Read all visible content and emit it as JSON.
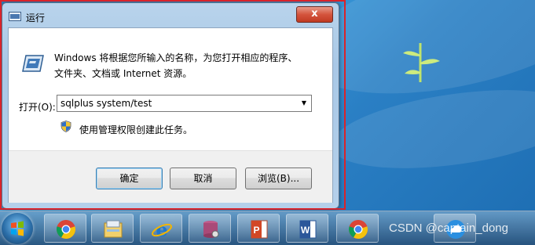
{
  "window": {
    "title": "运行",
    "close_label": "x"
  },
  "dialog": {
    "description_line1": "Windows 将根据您所输入的名称，为您打开相应的程序、",
    "description_line2": "文件夹、文档或 Internet 资源。",
    "open_label": "打开(O):",
    "open_value": "sqlplus system/test",
    "admin_note": "使用管理权限创建此任务。",
    "buttons": {
      "ok": "确定",
      "cancel": "取消",
      "browse": "浏览(B)..."
    }
  },
  "taskbar": {
    "items": [
      "chrome-icon",
      "file-explorer-icon",
      "internet-explorer-icon",
      "database-tool-icon",
      "powerpoint-icon",
      "word-icon",
      "chrome-icon",
      "cloud-app-icon"
    ]
  },
  "watermark": "CSDN @captain_dong",
  "colors": {
    "annotation_red": "#d9232a",
    "close_button": "#c8432b",
    "desktop_blue": "#2f86c7"
  }
}
